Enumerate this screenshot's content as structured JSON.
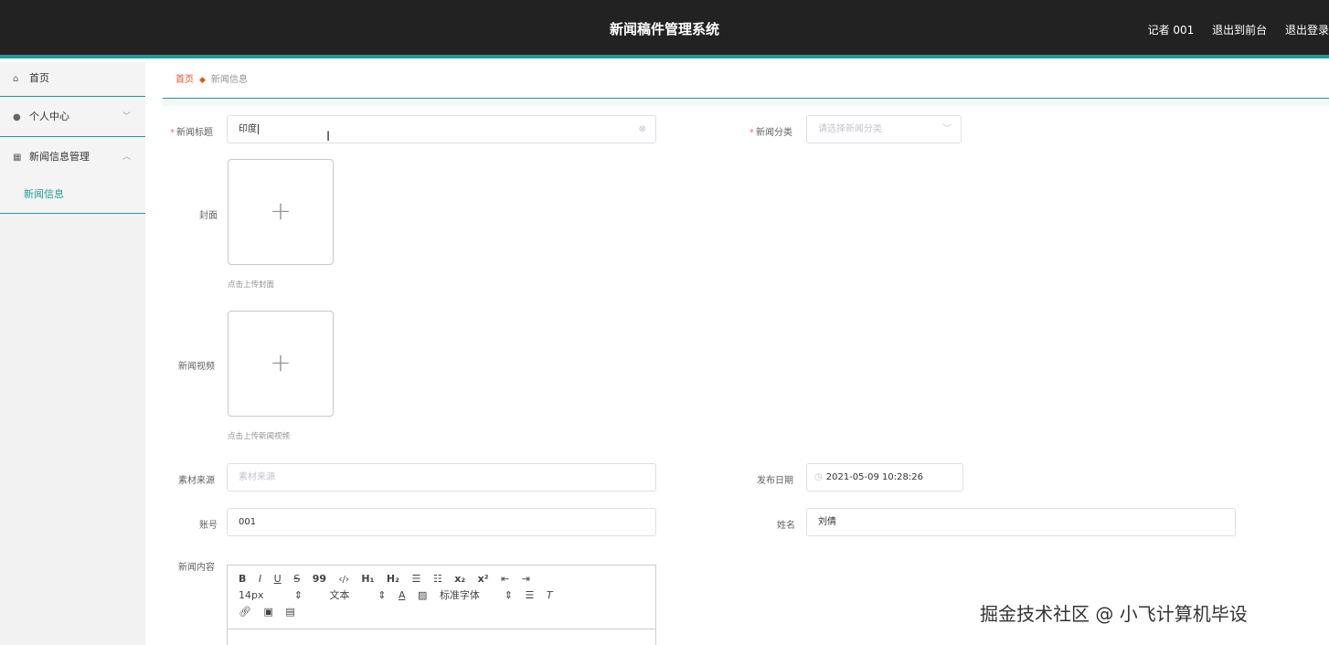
{
  "header": {
    "title": "新闻稿件管理系统",
    "user": "记者 001",
    "back_to_front": "退出到前台",
    "logout": "退出登录"
  },
  "sidebar": {
    "items": [
      {
        "label": "首页",
        "icon": "home-icon"
      },
      {
        "label": "个人中心",
        "icon": "user-icon",
        "arrow": "﹀"
      },
      {
        "label": "新闻信息管理",
        "icon": "grid-icon",
        "arrow": "︿"
      }
    ],
    "submenu": [
      "新闻信息"
    ]
  },
  "breadcrumb": {
    "home": "首页",
    "current": "新闻信息"
  },
  "form": {
    "title_label": "新闻标题",
    "title_value": "印度",
    "category_label": "新闻分类",
    "category_placeholder": "请选择新闻分类",
    "cover_label": "封面",
    "cover_tip": "点击上传封面",
    "video_label": "新闻视频",
    "video_tip": "点击上传新闻视频",
    "source_label": "素材来源",
    "source_placeholder": "素材来源",
    "date_label": "发布日期",
    "date_value": "2021-05-09 10:28:26",
    "account_label": "账号",
    "account_value": "001",
    "name_label": "姓名",
    "name_value": "刘倩",
    "content_label": "新闻内容"
  },
  "editor": {
    "row1": [
      "B",
      "I",
      "U",
      "S",
      "99",
      "‹/›",
      "H₁",
      "H₂",
      "☰",
      "☷",
      "x₂",
      "x²",
      "⇤",
      "⇥"
    ],
    "font_size": "14px",
    "text_type": "文本",
    "font_family": "标准字体"
  },
  "watermark": "掘金技术社区 @ 小飞计算机毕设"
}
